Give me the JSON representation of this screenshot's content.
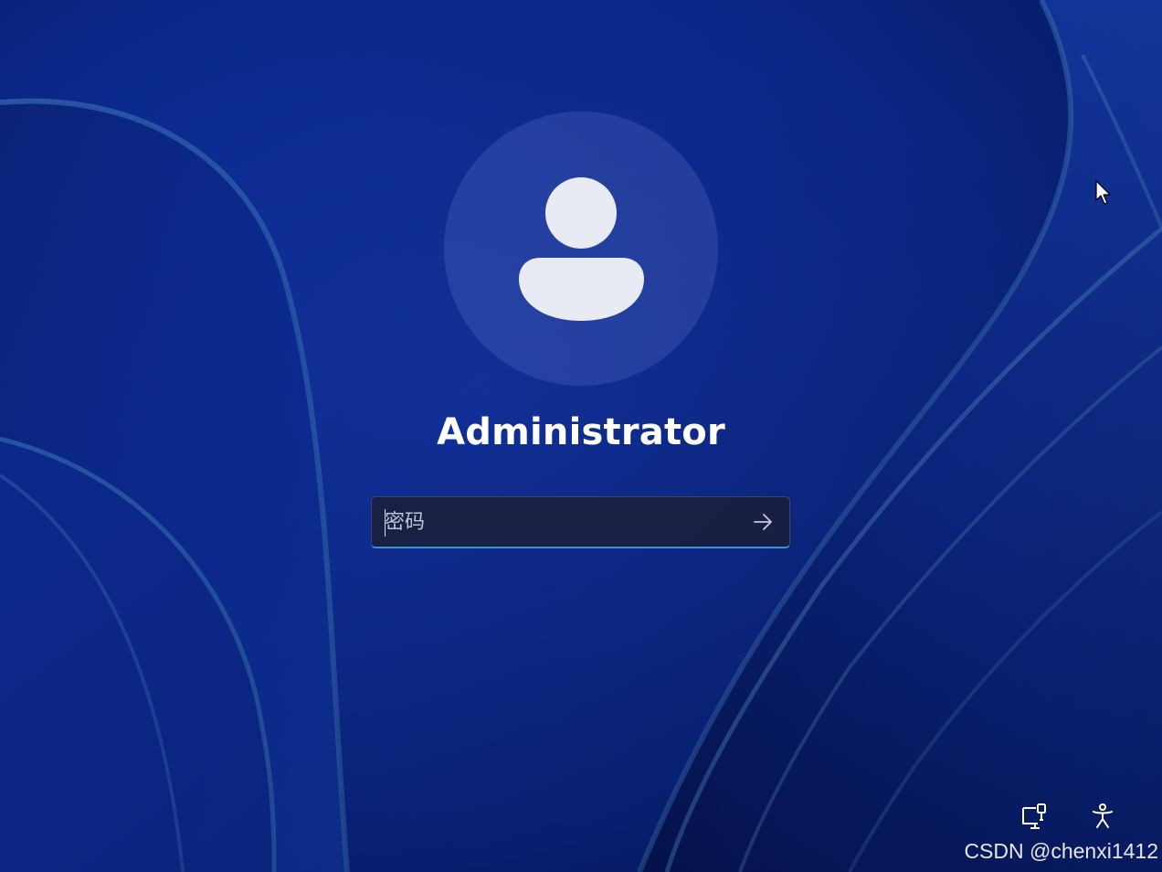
{
  "user": {
    "name": "Administrator",
    "avatar_icon": "person-icon"
  },
  "password_field": {
    "placeholder": "密码",
    "value": ""
  },
  "submit": {
    "icon": "arrow-right-icon"
  },
  "tray": {
    "network_icon": "network-icon",
    "accessibility_icon": "accessibility-icon"
  },
  "watermark": "CSDN @chenxi1412",
  "colors": {
    "background": "#0a2a8c",
    "accent": "#3b8ee0",
    "text": "#ffffff",
    "avatar_glyph": "#e8eaf4"
  }
}
